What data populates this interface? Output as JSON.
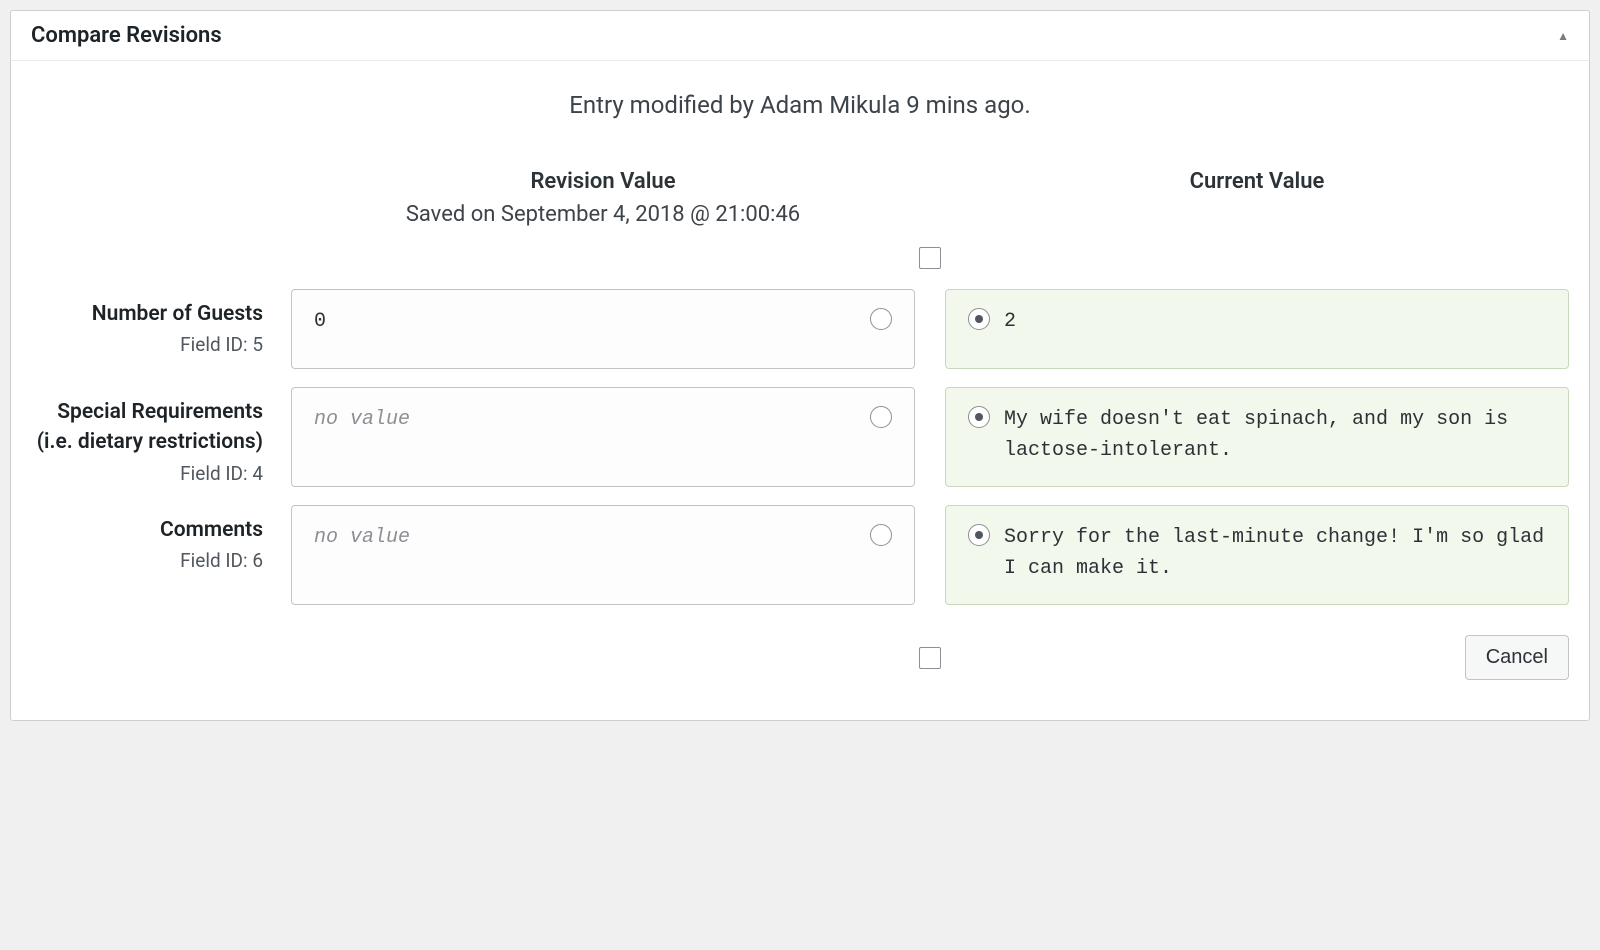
{
  "panel": {
    "title": "Compare Revisions",
    "modified_by": "Entry modified by Adam Mikula 9 mins ago."
  },
  "columns": {
    "revision": {
      "title": "Revision Value",
      "subtitle": "Saved on September 4, 2018 @ 21:00:46"
    },
    "current": {
      "title": "Current Value"
    }
  },
  "fields": [
    {
      "label": "Number of Guests",
      "field_id_text": "Field ID: 5",
      "revision_value": "0",
      "revision_no_value": false,
      "current_value": "2",
      "current_selected": true
    },
    {
      "label": "Special Requirements (i.e. dietary restrictions)",
      "field_id_text": "Field ID: 4",
      "revision_value": "no value",
      "revision_no_value": true,
      "current_value": "My wife doesn't eat spinach, and my son is lactose-intolerant.",
      "current_selected": true
    },
    {
      "label": "Comments",
      "field_id_text": "Field ID: 6",
      "revision_value": "no value",
      "revision_no_value": true,
      "current_value": "Sorry for the last-minute change! I'm so glad I can make it.",
      "current_selected": true
    }
  ],
  "actions": {
    "cancel": "Cancel"
  }
}
